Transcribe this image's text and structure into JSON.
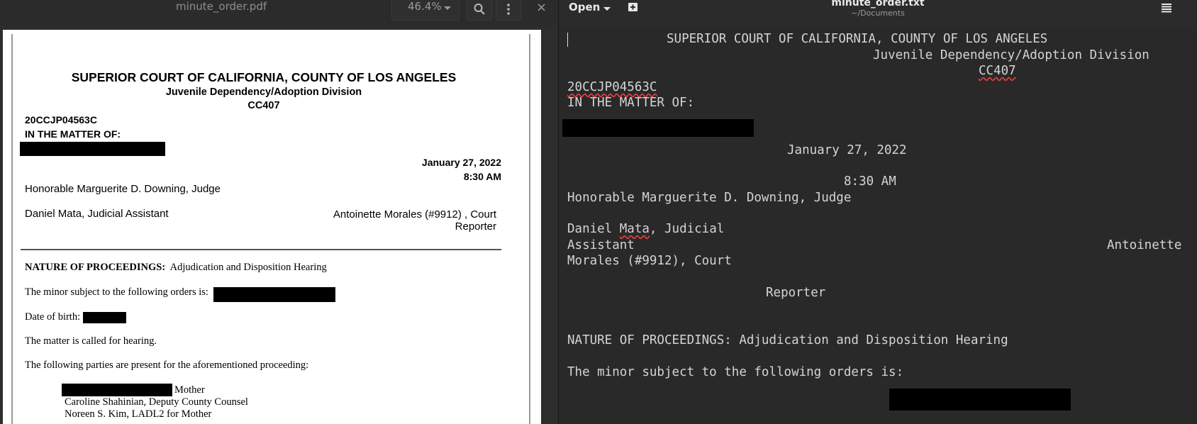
{
  "pdf_viewer": {
    "filename": "minute_order.pdf",
    "zoom": "46.4%",
    "close_glyph": "×",
    "page": {
      "court": "SUPERIOR COURT OF CALIFORNIA, COUNTY OF LOS ANGELES",
      "division": "Juvenile Dependency/Adoption Division",
      "dept": "CC407",
      "case_no": "20CCJP04563C",
      "matter": "IN THE MATTER OF:",
      "date": "January 27, 2022",
      "time": "8:30 AM",
      "judge": "Honorable Marguerite D. Downing, Judge",
      "assistant": "Daniel Mata, Judicial Assistant",
      "reporter_line1": "Antoinette Morales (#9912) , Court",
      "reporter_line2": "Reporter",
      "nature_label": "NATURE OF PROCEEDINGS:",
      "nature_value": "Adjudication and Disposition Hearing",
      "minor_subject": "The minor subject to the following orders is:",
      "dob": "Date of birth:",
      "called": "The matter is called for hearing.",
      "present": "The following parties are present for the aforementioned proceeding:",
      "party_mother": "Mother",
      "party_2": "Caroline Shahinian, Deputy County Counsel",
      "party_3": "Noreen S. Kim, LADL2 for Mother"
    }
  },
  "editor": {
    "open_label": "Open",
    "filename": "minute_order.txt",
    "path": "~/Documents",
    "lines": {
      "l1": "SUPERIOR COURT OF CALIFORNIA, COUNTY OF LOS ANGELES",
      "l2": "Juvenile Dependency/Adoption Division",
      "l3": "CC407",
      "l4": "20CCJP04563C",
      "l5": "IN THE MATTER OF:",
      "l6": "January 27, 2022",
      "l7": "8:30 AM",
      "l8": "Honorable Marguerite D. Downing, Judge",
      "l9a": "Daniel ",
      "l9b": "Mata",
      "l9c": ", Judicial",
      "l10": "Assistant",
      "l10b": "Antoinette",
      "l11": "Morales (#9912), Court",
      "l12": "Reporter",
      "l13": "NATURE OF PROCEEDINGS: Adjudication and Disposition Hearing",
      "l14": "The minor subject to the following orders is:"
    }
  }
}
